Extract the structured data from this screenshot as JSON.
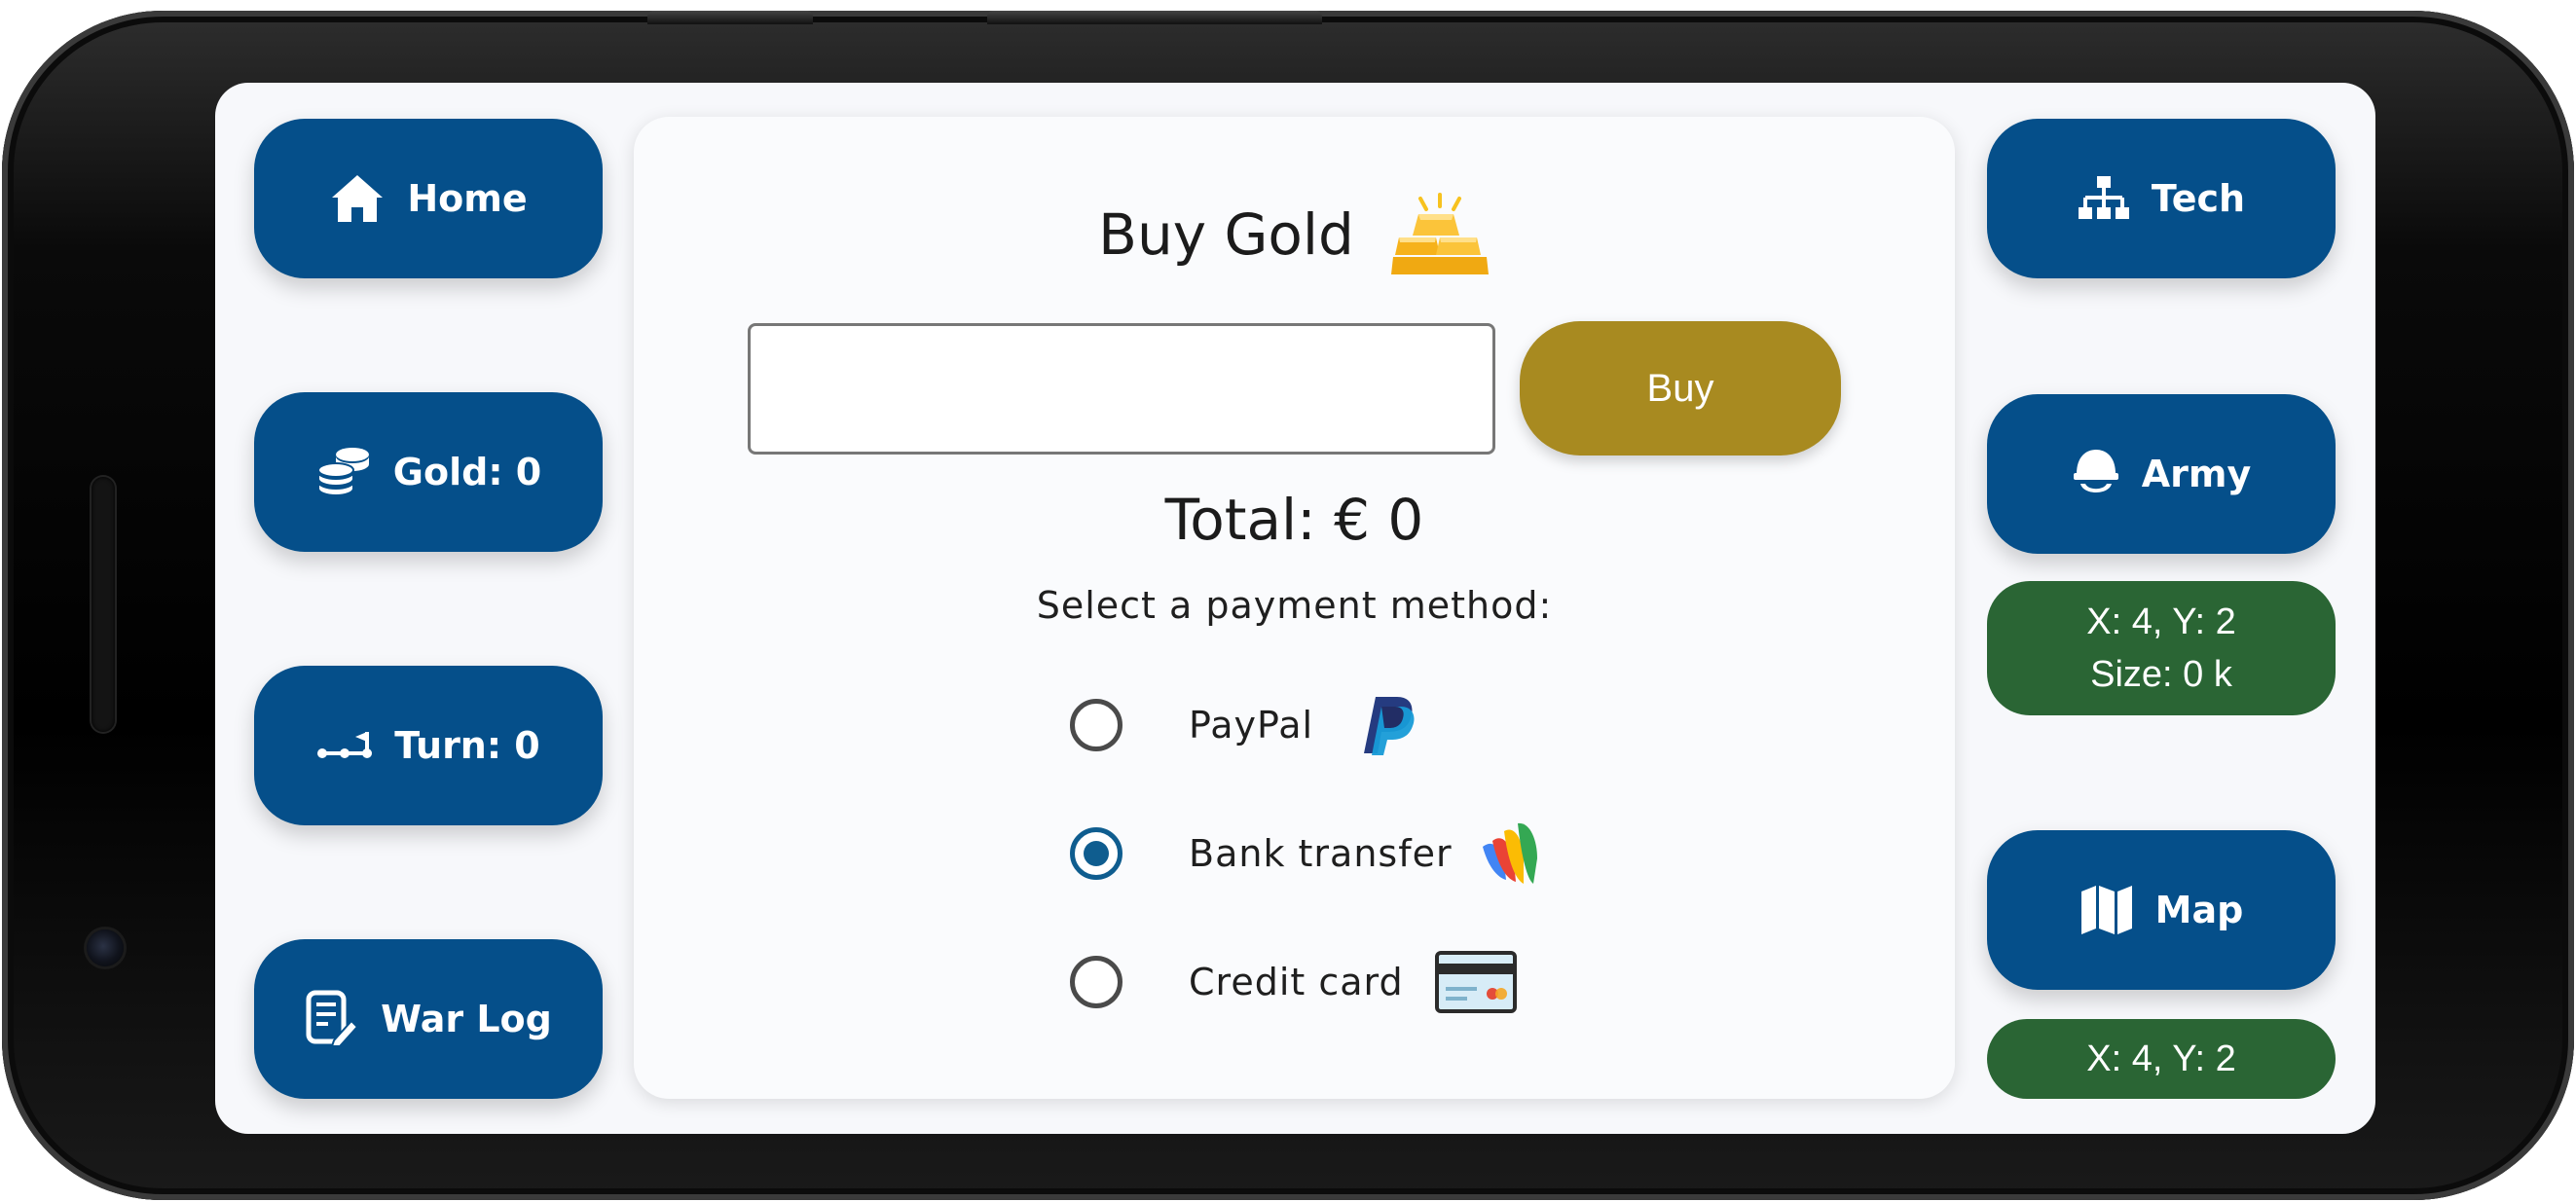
{
  "nav_left": {
    "home": {
      "label": "Home",
      "icon": "home-icon"
    },
    "gold": {
      "label": "Gold: 0",
      "icon": "coins-icon"
    },
    "turn": {
      "label": "Turn: 0",
      "icon": "route-icon"
    },
    "war_log": {
      "label": "War Log",
      "icon": "log-edit-icon"
    }
  },
  "nav_right": {
    "tech": {
      "label": "Tech",
      "icon": "sitemap-icon"
    },
    "army": {
      "label": "Army",
      "icon": "helmet-icon"
    },
    "army_info": {
      "line1": "X: 4, Y: 2",
      "line2": "Size: 0 k"
    },
    "map": {
      "label": "Map",
      "icon": "map-icon"
    },
    "map_info": {
      "line1": "X: 4, Y: 2"
    }
  },
  "purchase": {
    "title": "Buy Gold",
    "title_icon": "gold-bars-icon",
    "amount_value": "",
    "buy_label": "Buy",
    "total": "Total: € 0",
    "payment_prompt": "Select a payment method:",
    "methods": [
      {
        "label": "PayPal",
        "icon": "paypal-icon",
        "selected": false
      },
      {
        "label": "Bank transfer",
        "icon": "bank-transfer-icon",
        "selected": true
      },
      {
        "label": "Credit card",
        "icon": "credit-card-icon",
        "selected": false
      }
    ]
  },
  "colors": {
    "nav_button": "#054f8a",
    "info_box": "#2a6534",
    "buy_button": "#a88a20",
    "radio_selected": "#0f5d8f"
  }
}
